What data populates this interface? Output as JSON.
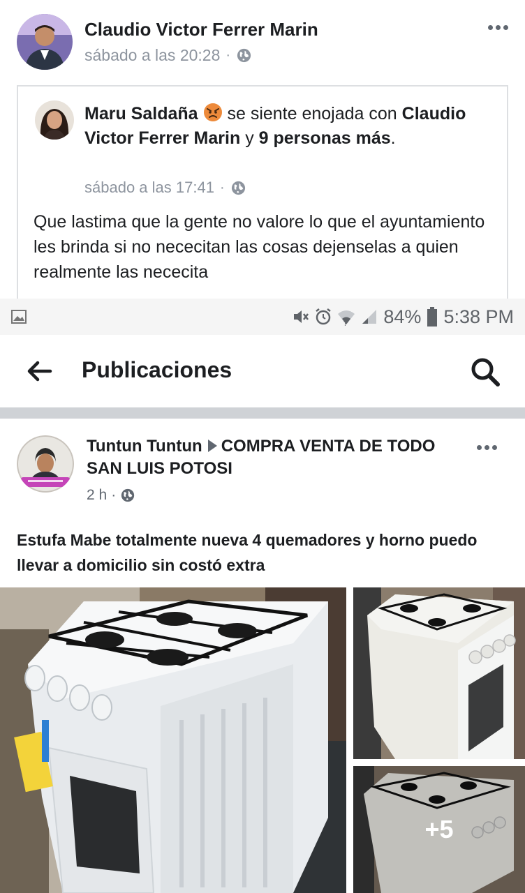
{
  "outer_post": {
    "author": "Claudio Victor Ferrer Marin",
    "timestamp": "sábado a las 20:28",
    "separator": "·",
    "privacy_icon": "globe-icon",
    "more_icon": "more-dots-icon",
    "shared": {
      "author": "Maru Saldaña",
      "feeling": "se siente enojada con",
      "emoji_icon": "angry-face-icon",
      "tagged": "Claudio Victor Ferrer Marin",
      "connector": "y",
      "others": "9 personas más",
      "end": ".",
      "timestamp": "sábado a las 17:41",
      "separator": "·",
      "text": "Que lastima que la gente no valore lo que el ayuntamiento les brinda si no nececitan las cosas dejenselas a quien realmente las nececita"
    }
  },
  "status_bar": {
    "battery": "84%",
    "time": "5:38 PM",
    "icons": [
      "image-icon",
      "mute-icon",
      "alarm-icon",
      "wifi-icon",
      "signal-icon",
      "battery-icon"
    ]
  },
  "app_bar": {
    "title": "Publicaciones",
    "back_icon": "back-arrow-icon",
    "search_icon": "search-icon"
  },
  "inner_post": {
    "author": "Tuntun Tuntun",
    "group": "COMPRA VENTA DE TODO SAN LUIS POTOSI",
    "timestamp": "2 h",
    "separator": "·",
    "text": "Estufa Mabe totalmente nueva 4 quemadores y horno puedo llevar a domicilio sin costó extra",
    "more_photos": "+5"
  },
  "colors": {
    "text": "#1c1e21",
    "meta": "#8d949e",
    "divider": "#cfd2d6",
    "status_bar": "#f5f5f5"
  }
}
